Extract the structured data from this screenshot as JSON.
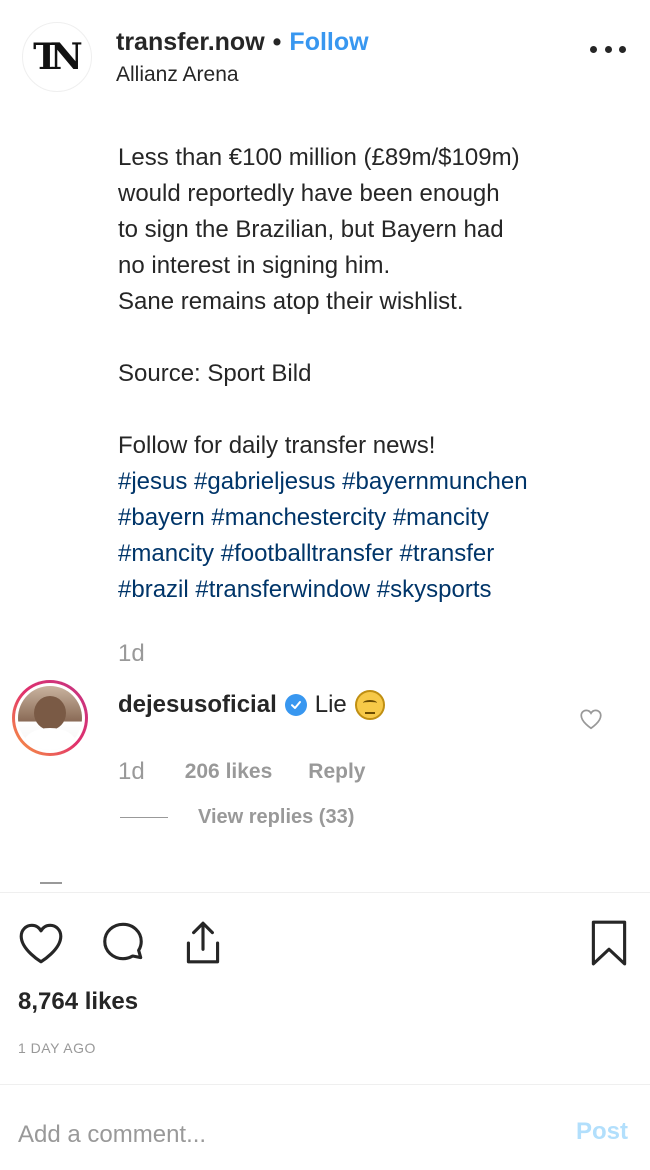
{
  "header": {
    "logo_text": "TN",
    "username": "transfer.now",
    "separator": "•",
    "follow_label": "Follow",
    "location": "Allianz Arena"
  },
  "caption": {
    "lines": [
      "Less than €100 million (£89m/$109m)",
      "would reportedly have been enough",
      "to sign the Brazilian, but Bayern had",
      "no interest in signing him.",
      "Sane remains atop their wishlist."
    ],
    "source": "Source:  Sport Bild",
    "cta": "Follow for daily transfer news!",
    "hashtags": [
      "#jesus",
      "#gabrieljesus",
      "#bayernmunchen",
      "#bayern",
      "#manchestercity",
      "#mancity",
      "#mancity",
      "#footballtransfer",
      "#transfer",
      "#brazil",
      "#transferwindow",
      "#skysports"
    ],
    "time": "1d"
  },
  "comment": {
    "username": "dejesusoficial",
    "text": "Lie",
    "emoji": "unamused-face-icon",
    "time": "1d",
    "likes": "206 likes",
    "reply_label": "Reply",
    "view_replies": "View replies (33)"
  },
  "actions": {
    "icons": [
      "heart-icon",
      "comment-icon",
      "share-icon",
      "bookmark-icon"
    ],
    "likes": "8,764 likes",
    "date": "1 DAY AGO"
  },
  "add_comment": {
    "placeholder": "Add a comment...",
    "value": "",
    "post_label": "Post"
  },
  "colors": {
    "accent": "#3897f0",
    "hashtag": "#003569",
    "muted": "#999999",
    "post_disabled": "#b2dffc"
  }
}
